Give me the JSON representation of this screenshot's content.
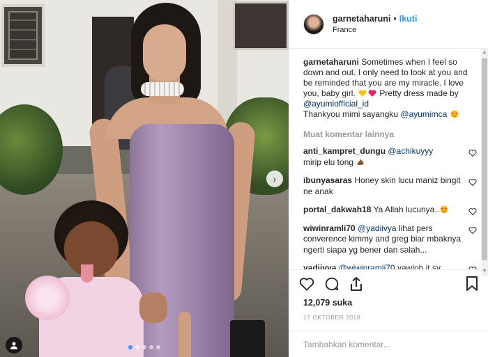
{
  "post": {
    "username": "garnetaharuni",
    "separator": "•",
    "follow_label": "Ikuti",
    "location": "France",
    "caption": {
      "username": "garnetaharuni",
      "text_1": "Sometimes when I feel so down and out. I only need to look at you and be reminded that you are my miracle. I love you, baby girl.",
      "text_2": "Pretty dress made by",
      "mention_1": "@ayumiofficial_id",
      "text_3": "Thankyou mimi sayangku",
      "mention_2": "@ayumimca"
    },
    "load_more_label": "Muat komentar lainnya",
    "comments": [
      {
        "user": "anti_kampret_dungu",
        "mention": "@achikuyyy",
        "text": "mirip elu tong"
      },
      {
        "user": "ibunyasaras",
        "mention": "",
        "text": "Honey skin lucu maniz bingit ne anak"
      },
      {
        "user": "portal_dakwah18",
        "mention": "",
        "text": "Ya Allah lucunya.."
      },
      {
        "user": "wiwinramli70",
        "mention": "@yadiivya",
        "text": "lihat pers converence kimmy and greg biar mbaknya ngerti siapa yg bener dan salah..."
      },
      {
        "user": "yadiivya",
        "mention": "@wiwinramli70",
        "text": "yawloh it sy komen kpn prescon kpn, basii mbak sy"
      }
    ],
    "likes": "12,079 suka",
    "date": "17 OKTOBER 2018",
    "add_comment_placeholder": "Tambahkan komentar...",
    "carousel": {
      "total": 5,
      "active": 1
    },
    "icons": {
      "heart": "heart-icon",
      "comment": "comment-icon",
      "share": "share-icon",
      "save": "bookmark-icon",
      "next": "chevron-right-icon",
      "tag": "user-tag-icon"
    },
    "colors": {
      "link": "#3897f0",
      "mention": "#003569",
      "muted": "#999999",
      "text": "#262626"
    }
  }
}
